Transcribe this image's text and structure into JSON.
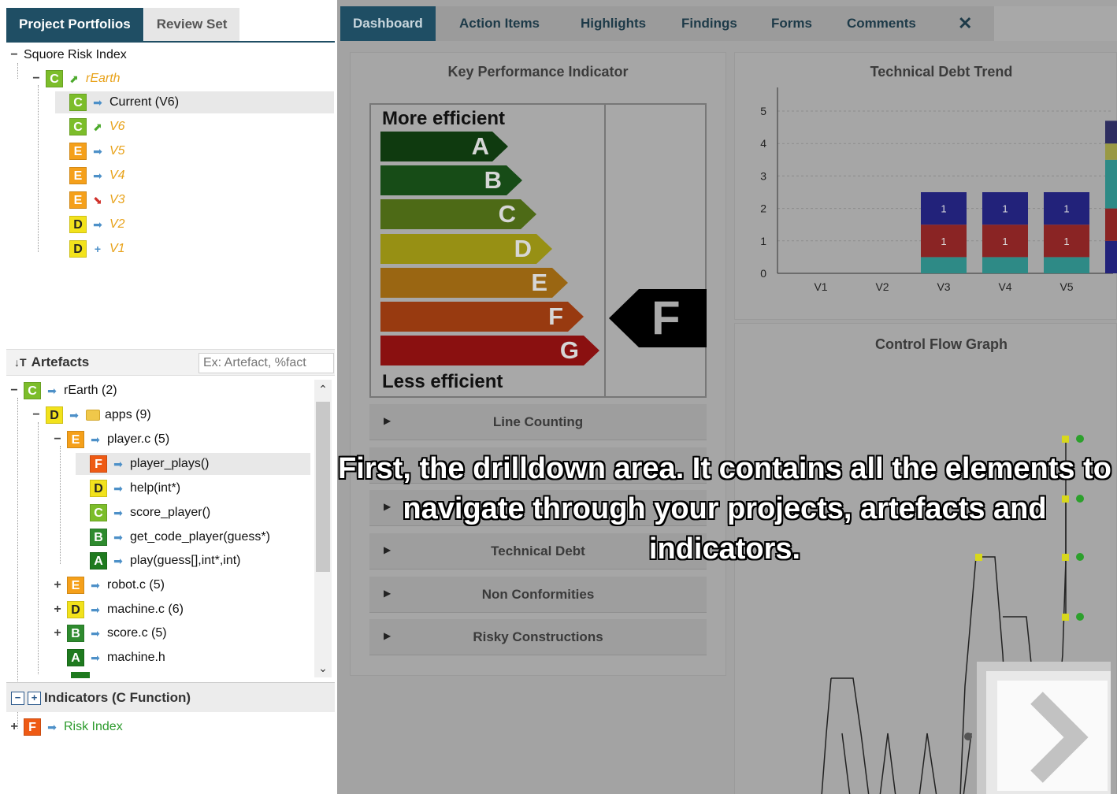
{
  "left": {
    "tabs": [
      "Project Portfolios",
      "Review Set"
    ],
    "portfolio_tree": [
      {
        "label": "Squore Risk Index",
        "exp": "−"
      },
      {
        "label": "rEarth",
        "exp": "−",
        "badge": "C",
        "trend": "up"
      },
      {
        "label": "Current (V6)",
        "badge": "C",
        "trend": "right"
      },
      {
        "label": "V6",
        "badge": "C",
        "trend": "up"
      },
      {
        "label": "V5",
        "badge": "E",
        "trend": "right"
      },
      {
        "label": "V4",
        "badge": "E",
        "trend": "right"
      },
      {
        "label": "V3",
        "badge": "E",
        "trend": "down"
      },
      {
        "label": "V2",
        "badge": "D",
        "trend": "right"
      },
      {
        "label": "V1",
        "badge": "D",
        "trend": "plus"
      }
    ],
    "artefacts": {
      "title": "Artefacts",
      "search_placeholder": "Ex: Artefact, %fact",
      "tree": [
        {
          "label": "rEarth (2)",
          "badge": "C",
          "exp": "−"
        },
        {
          "label": "apps (9)",
          "badge": "D",
          "exp": "−"
        },
        {
          "label": "player.c (5)",
          "badge": "E",
          "exp": "−"
        },
        {
          "label": "player_plays()",
          "badge": "F"
        },
        {
          "label": "help(int*)",
          "badge": "D"
        },
        {
          "label": "score_player()",
          "badge": "C"
        },
        {
          "label": "get_code_player(guess*)",
          "badge": "B"
        },
        {
          "label": "play(guess[],int*,int)",
          "badge": "A"
        },
        {
          "label": "robot.c (5)",
          "badge": "E",
          "exp": "+"
        },
        {
          "label": "machine.c (6)",
          "badge": "D",
          "exp": "+"
        },
        {
          "label": "score.c (5)",
          "badge": "B",
          "exp": "+"
        },
        {
          "label": "machine.h",
          "badge": "A"
        }
      ]
    },
    "indicators": {
      "title": "Indicators (C Function)",
      "item": {
        "label": "Risk Index",
        "badge": "F",
        "exp": "+"
      }
    }
  },
  "nav": {
    "tabs": [
      "Dashboard",
      "Action Items",
      "Highlights",
      "Findings",
      "Forms",
      "Comments"
    ],
    "active": "Dashboard",
    "tools_icon": "tools-icon"
  },
  "kpi": {
    "title": "Key Performance Indicator",
    "top_label": "More efficient",
    "bottom_label": "Less efficient",
    "grades": [
      "A",
      "B",
      "C",
      "D",
      "E",
      "F",
      "G"
    ],
    "current": "F"
  },
  "collapsibles": [
    "Line Counting",
    "Technical Debt",
    "Non Conformities",
    "Risky Constructions"
  ],
  "trend_title": "Technical Debt Trend",
  "cfg_title": "Control Flow Graph",
  "caption": "First, the drilldown area. It contains all the elements to navigate through your projects, artefacts and indicators.",
  "badge_colors": {
    "A": "#1e7a1e",
    "B": "#2e8b2e",
    "C": "#7cbd2a",
    "D": "#f2e21c",
    "E": "#f5a01a",
    "F": "#ee5a14",
    "G": "#d61a1a"
  },
  "chart_data": {
    "type": "bar",
    "title": "Technical Debt Trend",
    "categories": [
      "V1",
      "V2",
      "V3",
      "V4",
      "V5"
    ],
    "ylim": [
      0,
      5
    ],
    "yticks": [
      0,
      1,
      2,
      3,
      4,
      5
    ],
    "series": [
      {
        "values": [
          0,
          0,
          0.5,
          0.5,
          0.5
        ],
        "color": "#2e8a86"
      },
      {
        "values": [
          0,
          0,
          1,
          1,
          1
        ],
        "color": "#8a2424"
      },
      {
        "values": [
          0,
          0,
          1,
          1,
          1
        ],
        "color": "#22227a"
      }
    ],
    "data_labels": [
      {
        "category": "V3",
        "values": [
          "1",
          "1"
        ]
      },
      {
        "category": "V4",
        "values": [
          "1",
          "1"
        ]
      },
      {
        "category": "V5",
        "values": [
          "1",
          "1"
        ]
      }
    ]
  }
}
